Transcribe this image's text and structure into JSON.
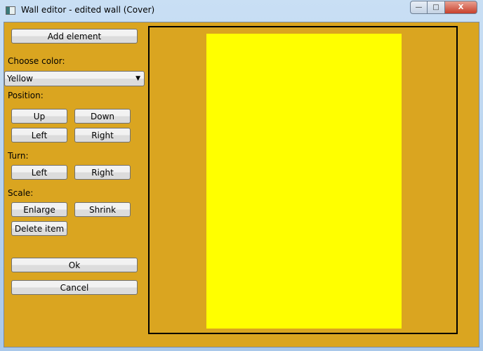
{
  "window": {
    "title": "Wall editor - edited wall (Cover)",
    "minimize": "—",
    "maximize": "□",
    "close": "X"
  },
  "sidebar": {
    "add_element": "Add element",
    "choose_color_label": "Choose color:",
    "color_value": "Yellow",
    "position_label": "Position:",
    "up": "Up",
    "down": "Down",
    "pos_left": "Left",
    "pos_right": "Right",
    "turn_label": "Turn:",
    "turn_left": "Left",
    "turn_right": "Right",
    "scale_label": "Scale:",
    "enlarge": "Enlarge",
    "shrink": "Shrink",
    "delete_item": "Delete item",
    "ok": "Ok",
    "cancel": "Cancel"
  },
  "colors": {
    "background": "#DAA520",
    "element": "#FFFF00"
  }
}
